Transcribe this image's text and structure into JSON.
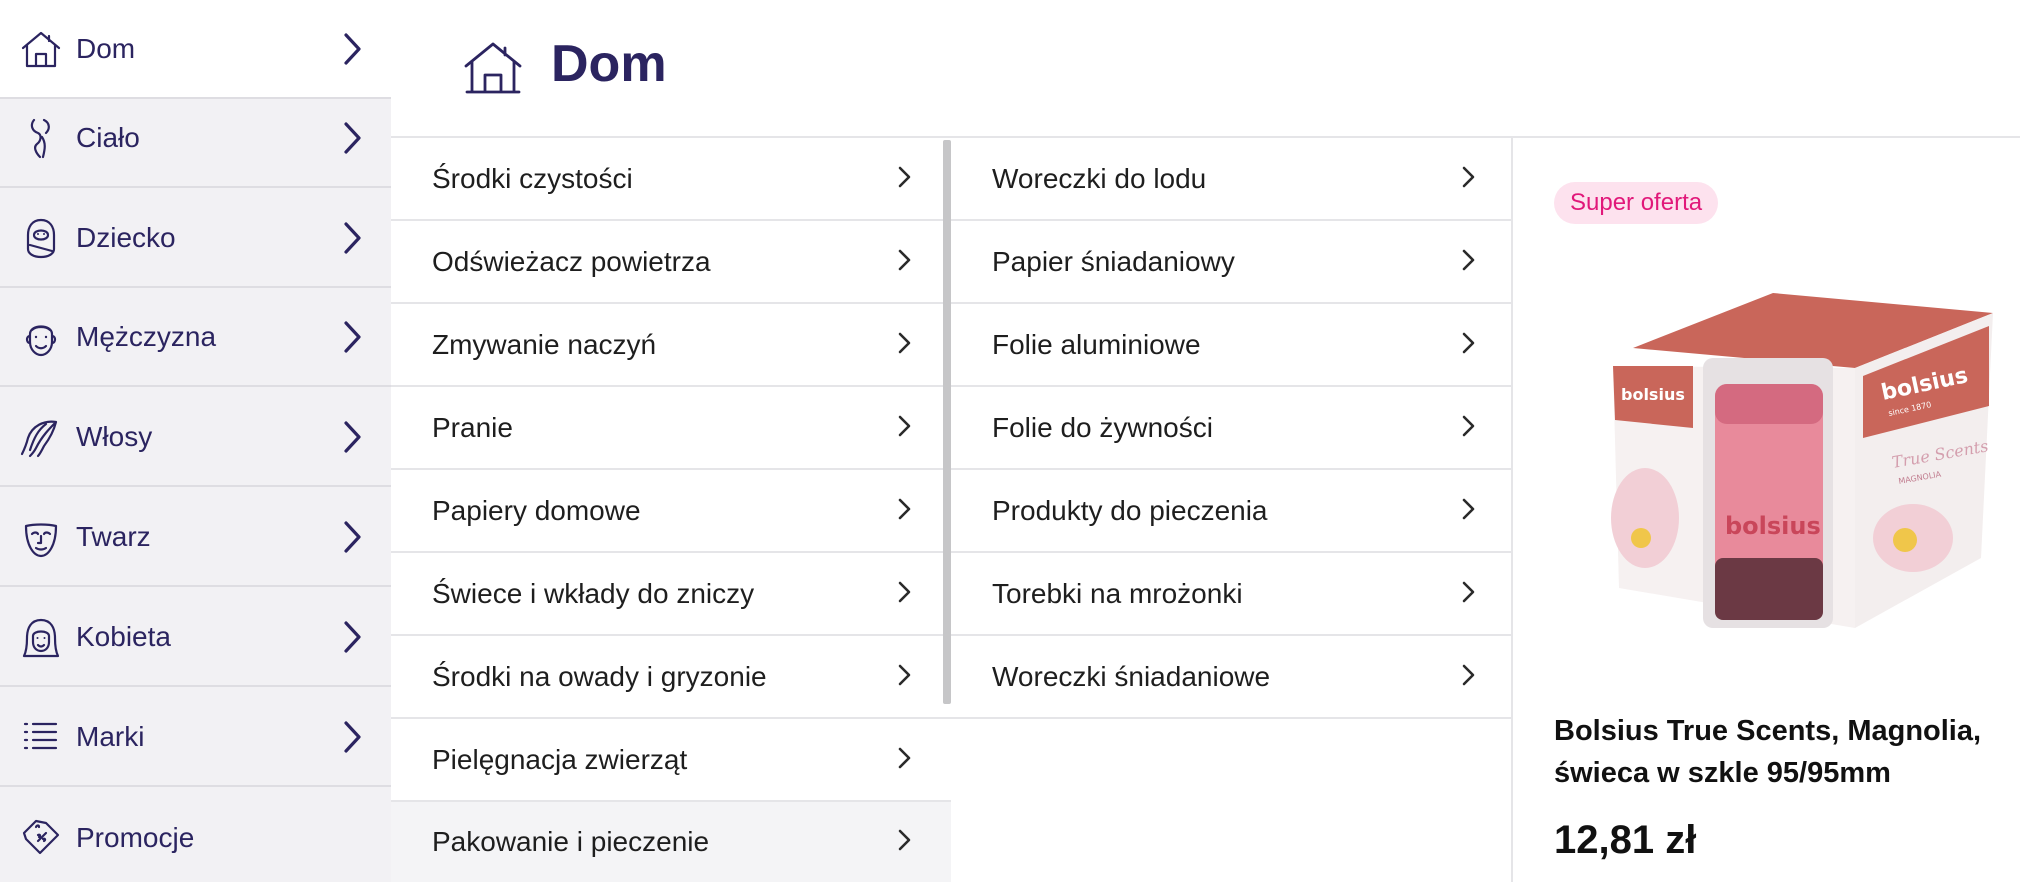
{
  "sidebar": {
    "items": [
      {
        "label": "Dom",
        "icon": "house-icon"
      },
      {
        "label": "Ciało",
        "icon": "body-icon"
      },
      {
        "label": "Dziecko",
        "icon": "baby-icon"
      },
      {
        "label": "Mężczyzna",
        "icon": "man-icon"
      },
      {
        "label": "Włosy",
        "icon": "hair-icon"
      },
      {
        "label": "Twarz",
        "icon": "face-icon"
      },
      {
        "label": "Kobieta",
        "icon": "woman-icon"
      },
      {
        "label": "Marki",
        "icon": "list-icon"
      },
      {
        "label": "Promocje",
        "icon": "price-tag-icon"
      }
    ]
  },
  "header": {
    "title": "Dom",
    "icon": "house-icon"
  },
  "categories_col1": [
    {
      "label": "Środki czystości"
    },
    {
      "label": "Odświeżacz powietrza"
    },
    {
      "label": "Zmywanie naczyń"
    },
    {
      "label": "Pranie"
    },
    {
      "label": "Papiery domowe"
    },
    {
      "label": "Świece i wkłady do zniczy"
    },
    {
      "label": "Środki na owady i gryzonie"
    },
    {
      "label": "Pielęgnacja zwierząt"
    },
    {
      "label": "Pakowanie i pieczenie"
    }
  ],
  "categories_col2": [
    {
      "label": "Woreczki do lodu"
    },
    {
      "label": "Papier śniadaniowy"
    },
    {
      "label": "Folie aluminiowe"
    },
    {
      "label": "Folie do żywności"
    },
    {
      "label": "Produkty do pieczenia"
    },
    {
      "label": "Torebki na mrożonki"
    },
    {
      "label": "Woreczki śniadaniowe"
    }
  ],
  "promo": {
    "badge": "Super oferta",
    "product_name": "Bolsius True Scents, Magnolia, świeca w szkle 95/95mm",
    "price": "12,81 zł",
    "image_brand_text": "bolsius",
    "image_since_text": "since 1870",
    "image_line_text": "True Scents",
    "image_scent_text": "MAGNOLIA"
  },
  "colors": {
    "brand": "#2b2460",
    "badge_bg": "#fde2ee",
    "badge_text": "#e1187a",
    "sidebar_bg": "#f2f1f4"
  }
}
